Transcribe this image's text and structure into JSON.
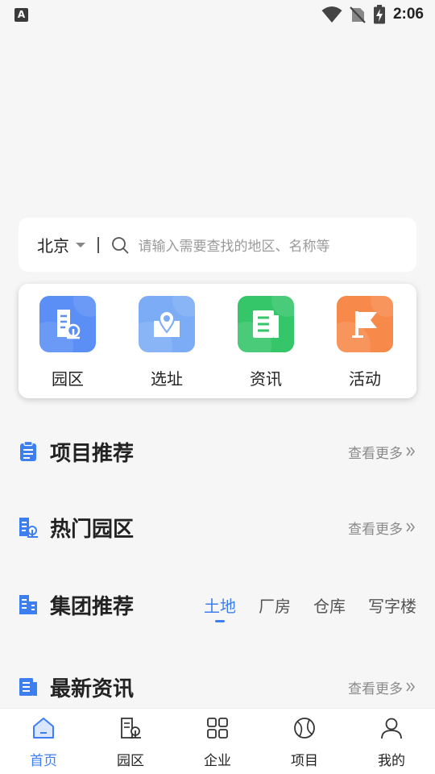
{
  "status_bar": {
    "time": "2:06",
    "indicator": "A"
  },
  "search": {
    "city": "北京",
    "placeholder": "请输入需要查找的地区、名称等"
  },
  "categories": [
    {
      "label": "园区",
      "icon": "park-building-icon",
      "color": "#5b8ff5"
    },
    {
      "label": "选址",
      "icon": "location-pin-icon",
      "color": "#7cacf5"
    },
    {
      "label": "资讯",
      "icon": "news-icon",
      "color": "#35c66a"
    },
    {
      "label": "活动",
      "icon": "flag-icon",
      "color": "#f7894a"
    }
  ],
  "sections": {
    "projects": {
      "title": "项目推荐",
      "more": "查看更多"
    },
    "parks": {
      "title": "热门园区",
      "more": "查看更多"
    },
    "group": {
      "title": "集团推荐",
      "tabs": [
        "土地",
        "厂房",
        "仓库",
        "写字楼"
      ],
      "active_tab": "土地"
    },
    "news": {
      "title": "最新资讯",
      "more": "查看更多"
    }
  },
  "bottom_nav": [
    {
      "label": "首页",
      "icon": "home-icon",
      "active": true
    },
    {
      "label": "园区",
      "icon": "park-icon",
      "active": false
    },
    {
      "label": "企业",
      "icon": "enterprise-grid-icon",
      "active": false
    },
    {
      "label": "项目",
      "icon": "project-ball-icon",
      "active": false
    },
    {
      "label": "我的",
      "icon": "profile-icon",
      "active": false
    }
  ],
  "colors": {
    "accent": "#3d7ff0",
    "background": "#f6f6f6"
  }
}
